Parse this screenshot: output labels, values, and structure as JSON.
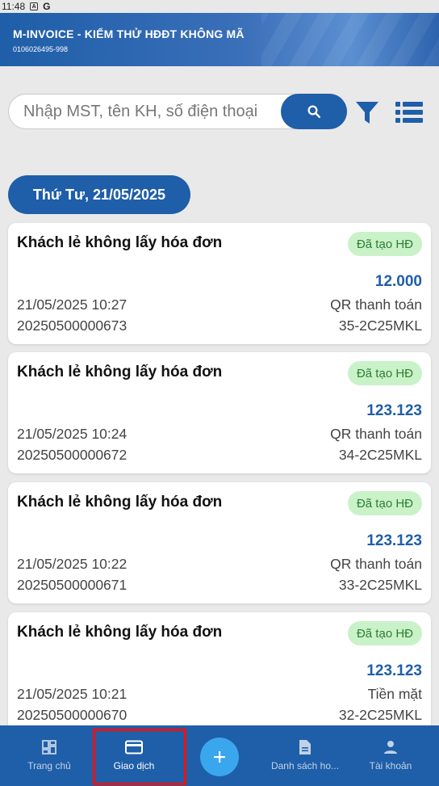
{
  "status_bar": {
    "time": "11:48",
    "icon_a": "A",
    "icon_g": "G"
  },
  "header": {
    "title": "M-INVOICE - KIỂM THỬ HĐĐT KHÔNG MÃ",
    "tax_code": "0106026495-998"
  },
  "search": {
    "placeholder": "Nhập MST, tên KH, số điện thoại",
    "value": ""
  },
  "date_label": "Thứ Tư, 21/05/2025",
  "transactions": [
    {
      "name": "Khách lẻ không lấy hóa đơn",
      "status": "Đã tạo HĐ",
      "amount": "12.000",
      "datetime": "21/05/2025 10:27",
      "method": "QR thanh toán",
      "code": "20250500000673",
      "serial": "35-2C25MKL"
    },
    {
      "name": "Khách lẻ không lấy hóa đơn",
      "status": "Đã tạo HĐ",
      "amount": "123.123",
      "datetime": "21/05/2025 10:24",
      "method": "QR thanh toán",
      "code": "20250500000672",
      "serial": "34-2C25MKL"
    },
    {
      "name": "Khách lẻ không lấy hóa đơn",
      "status": "Đã tạo HĐ",
      "amount": "123.123",
      "datetime": "21/05/2025 10:22",
      "method": "QR thanh toán",
      "code": "20250500000671",
      "serial": "33-2C25MKL"
    },
    {
      "name": "Khách lẻ không lấy hóa đơn",
      "status": "Đã tạo HĐ",
      "amount": "123.123",
      "datetime": "21/05/2025 10:21",
      "method": "Tiền mặt",
      "code": "20250500000670",
      "serial": "32-2C25MKL"
    }
  ],
  "bottom_nav": [
    {
      "label": "Trang chủ",
      "icon": "dashboard-icon"
    },
    {
      "label": "Giao dịch",
      "icon": "credit-card-icon",
      "active": true
    },
    {
      "label": "Danh sách ho...",
      "icon": "document-icon"
    },
    {
      "label": "Tài khoản",
      "icon": "person-icon"
    }
  ],
  "colors": {
    "primary": "#1f5ea8",
    "fab": "#3aa6ee",
    "badge_bg": "#c9f2c9",
    "badge_text": "#2e7d32",
    "highlight": "#ee1111"
  }
}
